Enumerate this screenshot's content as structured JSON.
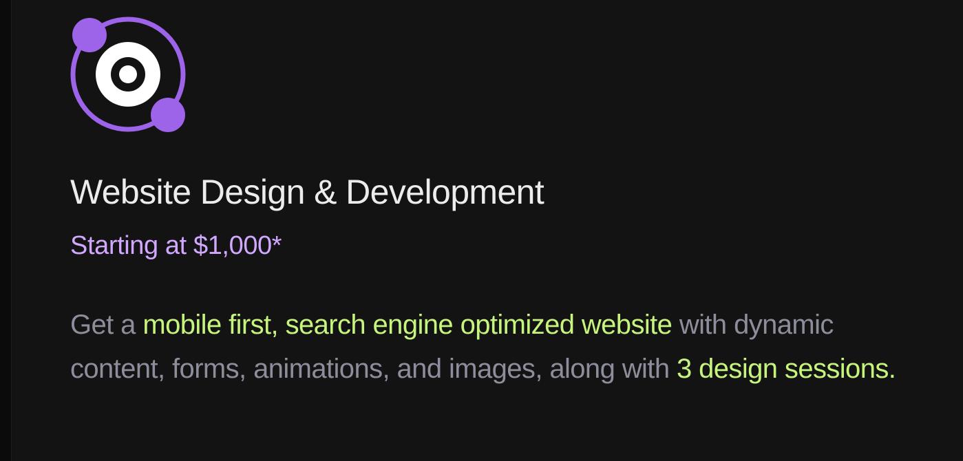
{
  "service": {
    "icon_name": "orbit-target-icon",
    "title": "Website Design &  Development",
    "price": "Starting at $1,000*",
    "description": {
      "part1": "Get a ",
      "highlight1": "mobile first, search engine optimized website",
      "part2": " with dynamic content, forms, animations, and images, along with ",
      "highlight2": "3 design sessions."
    }
  },
  "colors": {
    "background": "#131313",
    "title": "#ececec",
    "price": "#d2a8ff",
    "body_text": "#8d8d9b",
    "highlight": "#c7f47c",
    "icon_purple": "#9d63e8",
    "icon_white": "#ffffff"
  }
}
